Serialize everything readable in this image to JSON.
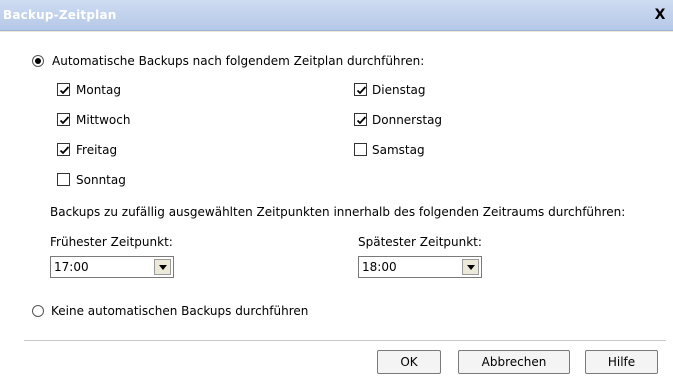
{
  "window": {
    "title": "Backup-Zeitplan",
    "close_glyph": "X"
  },
  "schedule_option": {
    "label": "Automatische Backups nach folgendem Zeitplan durchführen:",
    "selected": true
  },
  "days": [
    {
      "label": "Montag",
      "checked": true
    },
    {
      "label": "Dienstag",
      "checked": true
    },
    {
      "label": "Mittwoch",
      "checked": true
    },
    {
      "label": "Donnerstag",
      "checked": true
    },
    {
      "label": "Freitag",
      "checked": true
    },
    {
      "label": "Samstag",
      "checked": false
    },
    {
      "label": "Sonntag",
      "checked": false
    }
  ],
  "random_time_text": "Backups zu zufällig ausgewählten Zeitpunkten innerhalb des folgenden Zeitraums durchführen:",
  "earliest": {
    "label": "Frühester Zeitpunkt:",
    "value": "17:00"
  },
  "latest": {
    "label": "Spätester Zeitpunkt:",
    "value": "18:00"
  },
  "no_backup_option": {
    "label": "Keine automatischen Backups durchführen",
    "selected": false
  },
  "buttons": {
    "ok": "OK",
    "cancel": "Abbrechen",
    "help": "Hilfe"
  }
}
